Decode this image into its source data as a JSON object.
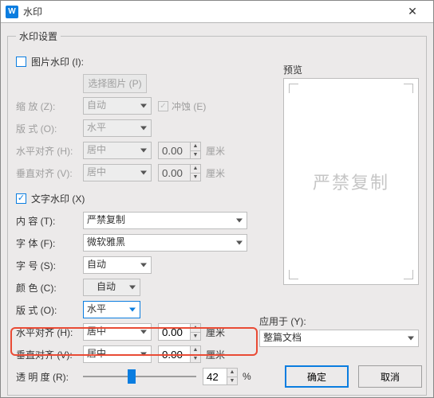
{
  "window": {
    "title": "水印",
    "close": "✕",
    "logo": "W"
  },
  "group": {
    "legend": "水印设置"
  },
  "image": {
    "checkbox_label": "图片水印 (I):",
    "select_file": "选择图片 (P)",
    "zoom_label": "缩  放 (Z):",
    "zoom_value": "自动",
    "washout_label": "冲蚀 (E)",
    "layout_label": "版  式 (O):",
    "layout_value": "水平",
    "halign_label": "水平对齐 (H):",
    "halign_value": "居中",
    "halign_num": "0.00",
    "valign_label": "垂直对齐 (V):",
    "valign_value": "居中",
    "valign_num": "0.00",
    "unit": "厘米"
  },
  "text": {
    "checkbox_label": "文字水印 (X)",
    "content_label": "内  容 (T):",
    "content_value": "严禁复制",
    "font_label": "字  体 (F):",
    "font_value": "微软雅黑",
    "size_label": "字  号 (S):",
    "size_value": "自动",
    "color_label": "颜  色 (C):",
    "color_value": "自动",
    "layout_label": "版  式 (O):",
    "layout_value": "水平",
    "halign_label": "水平对齐 (H):",
    "halign_value": "居中",
    "halign_num": "0.00",
    "valign_label": "垂直对齐 (V):",
    "valign_value": "居中",
    "valign_num": "0.00",
    "unit": "厘米",
    "opacity_label": "透 明 度 (R):",
    "opacity_value": "42",
    "opacity_unit": "%"
  },
  "preview": {
    "label": "预览",
    "watermark": "严禁复制"
  },
  "apply": {
    "label": "应用于 (Y):",
    "value": "整篇文档"
  },
  "footer": {
    "ok": "确定",
    "cancel": "取消"
  }
}
